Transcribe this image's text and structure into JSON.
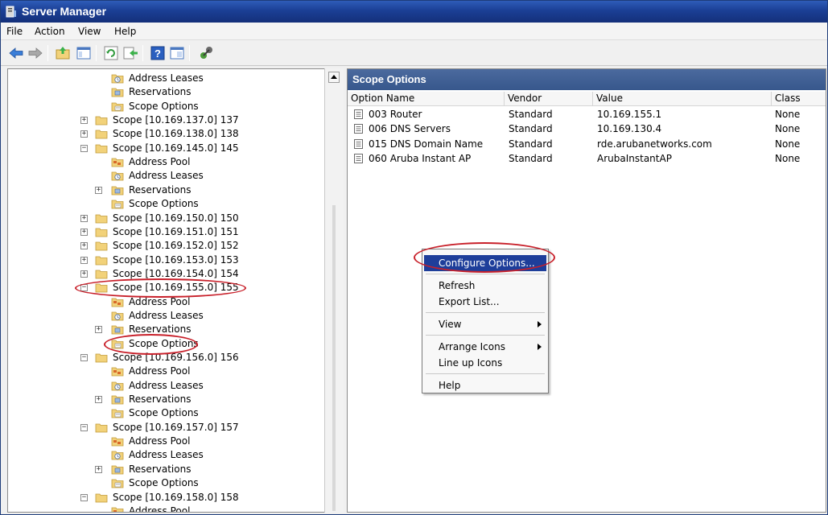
{
  "window": {
    "title": "Server Manager"
  },
  "menu": [
    "File",
    "Action",
    "View",
    "Help"
  ],
  "toolbar": {
    "icons": [
      "back-arrow-icon",
      "forward-arrow-icon",
      "up-folder-icon",
      "show-hide-console-tree-icon",
      "refresh-icon",
      "export-list-icon",
      "help-icon",
      "properties-icon",
      "connect-icon"
    ]
  },
  "tree": {
    "rows": [
      {
        "label": "Address Leases",
        "icon": "address-leases-icon",
        "level": 2,
        "expander": ""
      },
      {
        "label": "Reservations",
        "icon": "reservations-icon",
        "level": 2,
        "expander": ""
      },
      {
        "label": "Scope Options",
        "icon": "scope-options-icon",
        "level": 2,
        "expander": ""
      },
      {
        "label": "Scope [10.169.137.0] 137",
        "icon": "folder-icon",
        "level": 1,
        "expander": "+"
      },
      {
        "label": "Scope [10.169.138.0] 138",
        "icon": "folder-icon",
        "level": 1,
        "expander": "+"
      },
      {
        "label": "Scope [10.169.145.0] 145",
        "icon": "folder-icon",
        "level": 1,
        "expander": "-"
      },
      {
        "label": "Address Pool",
        "icon": "address-pool-icon",
        "level": 2,
        "expander": ""
      },
      {
        "label": "Address Leases",
        "icon": "address-leases-icon",
        "level": 2,
        "expander": ""
      },
      {
        "label": "Reservations",
        "icon": "reservations-icon",
        "level": 2,
        "expander": "+"
      },
      {
        "label": "Scope Options",
        "icon": "scope-options-icon",
        "level": 2,
        "expander": ""
      },
      {
        "label": "Scope [10.169.150.0] 150",
        "icon": "folder-icon",
        "level": 1,
        "expander": "+"
      },
      {
        "label": "Scope [10.169.151.0] 151",
        "icon": "folder-icon",
        "level": 1,
        "expander": "+"
      },
      {
        "label": "Scope [10.169.152.0] 152",
        "icon": "folder-icon",
        "level": 1,
        "expander": "+"
      },
      {
        "label": "Scope [10.169.153.0] 153",
        "icon": "folder-icon",
        "level": 1,
        "expander": "+"
      },
      {
        "label": "Scope [10.169.154.0] 154",
        "icon": "folder-icon",
        "level": 1,
        "expander": "+"
      },
      {
        "label": "Scope [10.169.155.0] 155",
        "icon": "folder-icon",
        "level": 1,
        "expander": "-"
      },
      {
        "label": "Address Pool",
        "icon": "address-pool-icon",
        "level": 2,
        "expander": ""
      },
      {
        "label": "Address Leases",
        "icon": "address-leases-icon",
        "level": 2,
        "expander": ""
      },
      {
        "label": "Reservations",
        "icon": "reservations-icon",
        "level": 2,
        "expander": "+"
      },
      {
        "label": "Scope Options",
        "icon": "scope-options-icon",
        "level": 2,
        "expander": ""
      },
      {
        "label": "Scope [10.169.156.0] 156",
        "icon": "folder-icon",
        "level": 1,
        "expander": "-"
      },
      {
        "label": "Address Pool",
        "icon": "address-pool-icon",
        "level": 2,
        "expander": ""
      },
      {
        "label": "Address Leases",
        "icon": "address-leases-icon",
        "level": 2,
        "expander": ""
      },
      {
        "label": "Reservations",
        "icon": "reservations-icon",
        "level": 2,
        "expander": "+"
      },
      {
        "label": "Scope Options",
        "icon": "scope-options-icon",
        "level": 2,
        "expander": ""
      },
      {
        "label": "Scope [10.169.157.0] 157",
        "icon": "folder-icon",
        "level": 1,
        "expander": "-"
      },
      {
        "label": "Address Pool",
        "icon": "address-pool-icon",
        "level": 2,
        "expander": ""
      },
      {
        "label": "Address Leases",
        "icon": "address-leases-icon",
        "level": 2,
        "expander": ""
      },
      {
        "label": "Reservations",
        "icon": "reservations-icon",
        "level": 2,
        "expander": "+"
      },
      {
        "label": "Scope Options",
        "icon": "scope-options-icon",
        "level": 2,
        "expander": ""
      },
      {
        "label": "Scope [10.169.158.0] 158",
        "icon": "folder-icon",
        "level": 1,
        "expander": "-"
      },
      {
        "label": "Address Pool",
        "icon": "address-pool-icon",
        "level": 2,
        "expander": ""
      }
    ]
  },
  "details": {
    "title": "Scope Options",
    "columns": [
      "Option Name",
      "Vendor",
      "Value",
      "Class"
    ],
    "rows": [
      {
        "name": "003 Router",
        "vendor": "Standard",
        "value": "10.169.155.1",
        "class": "None"
      },
      {
        "name": "006 DNS Servers",
        "vendor": "Standard",
        "value": "10.169.130.4",
        "class": "None"
      },
      {
        "name": "015 DNS Domain Name",
        "vendor": "Standard",
        "value": "rde.arubanetworks.com",
        "class": "None"
      },
      {
        "name": "060 Aruba Instant AP",
        "vendor": "Standard",
        "value": "ArubaInstantAP",
        "class": "None"
      }
    ]
  },
  "context_menu": {
    "items": [
      {
        "label": "Configure Options...",
        "selected": true,
        "submenu": false
      },
      {
        "separator": true
      },
      {
        "label": "Refresh",
        "selected": false,
        "submenu": false
      },
      {
        "label": "Export List...",
        "selected": false,
        "submenu": false
      },
      {
        "separator": true
      },
      {
        "label": "View",
        "selected": false,
        "submenu": true
      },
      {
        "separator": true
      },
      {
        "label": "Arrange Icons",
        "selected": false,
        "submenu": true
      },
      {
        "label": "Line up Icons",
        "selected": false,
        "submenu": false
      },
      {
        "separator": true
      },
      {
        "label": "Help",
        "selected": false,
        "submenu": false
      }
    ]
  },
  "colors": {
    "title_bar": "#1b3f95",
    "pane_header": "#37578c",
    "menu_highlight": "#1e3e9a",
    "annotation": "#c8202a",
    "folder": "#f2d27a"
  }
}
